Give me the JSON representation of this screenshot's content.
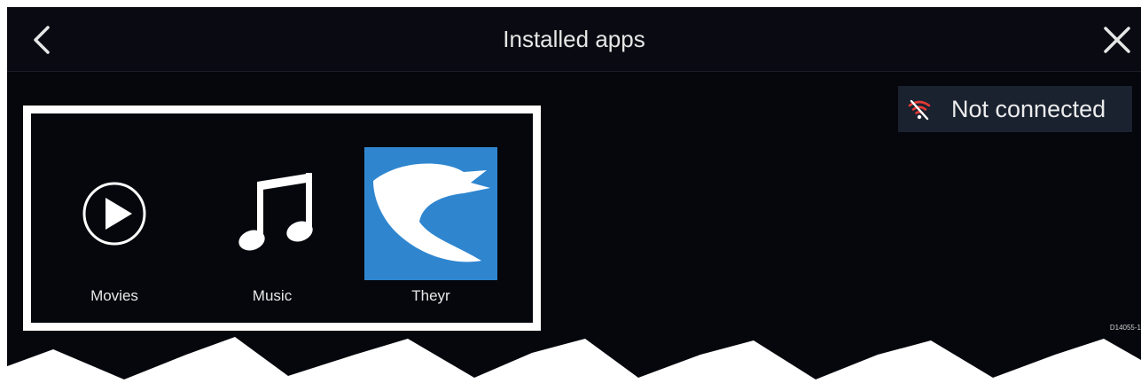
{
  "header": {
    "title": "Installed apps"
  },
  "status": {
    "text": "Not connected",
    "icon": "wifi-disconnected-icon",
    "icon_color": "#e53935"
  },
  "apps": [
    {
      "label": "Movies",
      "icon": "play-circle-icon"
    },
    {
      "label": "Music",
      "icon": "music-note-icon"
    },
    {
      "label": "Theyr",
      "icon": "theyr-logo-icon",
      "icon_bg": "#2f86cf"
    }
  ],
  "footer": {
    "reference_code": "D14055-1"
  },
  "colors": {
    "background": "#06070d",
    "highlight_border": "#ffffff",
    "status_chip": "#1a2230"
  }
}
